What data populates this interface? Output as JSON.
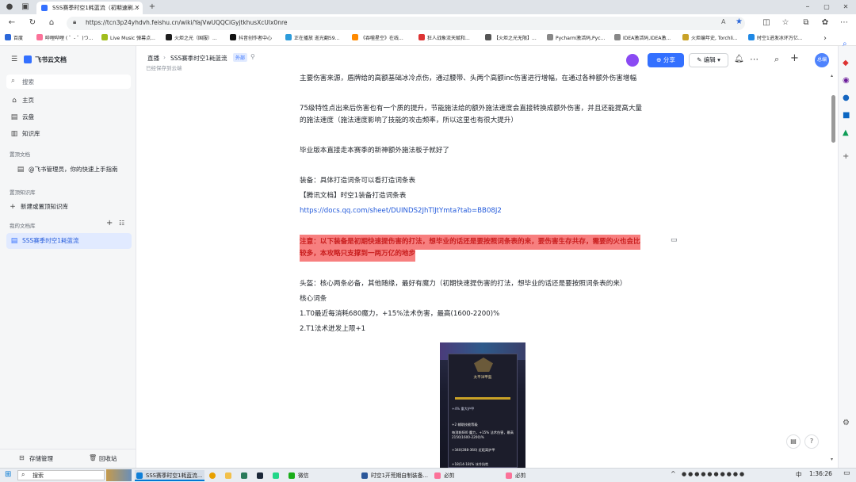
{
  "browser": {
    "tabs": [
      {
        "title": "SSS赛季时空1耗蓝流（初期速刷…",
        "active": true
      }
    ],
    "url": "https://tcn3p24yhdvh.feishu.cn/wiki/YajVwUQQCiGyjtkhusXcUlx0nre",
    "bookmarks": [
      {
        "label": "百度",
        "color": "#2b67d9"
      },
      {
        "label": "哔哩哔哩 ( ゜- ゜)つ...",
        "color": "#fb7299"
      },
      {
        "label": "Live Music 弹幕点...",
        "color": "#a1bd1c"
      },
      {
        "label": "火炬之光（国服）...",
        "color": "#1e1e1e"
      },
      {
        "label": "抖音创作者中心",
        "color": "#111111"
      },
      {
        "label": "正在播放 逝光翻59...",
        "color": "#2d9cdb"
      },
      {
        "label": "《吞噬星空》在线...",
        "color": "#ff8a00"
      },
      {
        "label": "狂人战象流天赋和...",
        "color": "#d33"
      },
      {
        "label": "【火炬之光无限】...",
        "color": "#555"
      },
      {
        "label": "Pycharm激活码,Pyc...",
        "color": "#888"
      },
      {
        "label": "IDEA激活码,IDEA激...",
        "color": "#888"
      },
      {
        "label": "火炬编年史, Torchli...",
        "color": "#c9a227"
      },
      {
        "label": "时空1进发冰环万亿...",
        "color": "#1e88e5"
      }
    ]
  },
  "sidebar": {
    "logo": "飞书云文档",
    "search_placeholder": "搜索",
    "nav": [
      {
        "label": "主页",
        "icon": "home-icon"
      },
      {
        "label": "云盘",
        "icon": "cloud-drive-icon"
      },
      {
        "label": "知识库",
        "icon": "knowledge-base-icon"
      }
    ],
    "pinned_docs_title": "置顶文档",
    "pinned_doc": "@飞书管理员，你的快速上手指南",
    "pinned_kb_title": "置顶知识库",
    "new_kb_label": "新建或置顶知识库",
    "my_lib_title": "我的文档库",
    "my_lib_item": "SSS赛季时空1耗蓝流",
    "storage_label": "存储管理",
    "trash_label": "回收站"
  },
  "header": {
    "breadcrumb_root": "直播",
    "breadcrumb_doc": "SSS赛季时空1耗蓝流",
    "badge": "外部",
    "saved_status": "已经保存到云端",
    "share_label": "分享",
    "edit_label": "编辑",
    "avatar_text": "总编"
  },
  "content": {
    "lines": [
      "主要伤害来源，盾牌给的高额基础冰冷点伤，通过腰带、头两个高额inc伤害进行增幅，在通过各种额外伤害增幅",
      "75级特性点出来后伤害也有一个质的提升，节能施法给的额外施法速度会直接转换成额外伤害，并且还能提高大量",
      "的施法速度（施法速度影响了技能的攻击频率，所以这里也有很大提升）",
      "毕业版本直接走本赛季的新神额外施法板子就好了",
      "装备：具体打造词条可以看打造词条表",
      "【腾讯文档】时空1装备打造词条表",
      "https://docs.qq.com/sheet/DUINDS2JhTlJtYmta?tab=BB08J2",
      "注意：以下装备是初期快速提伤害的打法，想毕业的话还是要按照词条表的来，要伤害生存共存，需要的火也会比",
      "较多，本攻略只支撑到一两万亿的地步",
      "头盔：核心两条必备，其他随缘，最好有魔力（初期快速提伤害的打法，想毕业的话还是要按照词条表的来）",
      "核心词条",
      "1.T0最近每消耗680魔力，+15%法术伤害，最高(1600-2200)%",
      "2.T1法术迸发上限+1"
    ],
    "image_card": {
      "title": "太平洋甲盔",
      "lines": [
        "+2 辅助技能等级",
        "每消耗680 魔力，+15% 法术伤害，最高2150(1600-2200)%",
        "+340(288-360) 近距离护甲",
        "+4% 重大护甲",
        "+18(14-18)% 冰冷抗性"
      ]
    }
  },
  "taskbar": {
    "search_label": "搜索",
    "items": [
      "SSS赛季时空1耗蓝流...",
      "微信",
      "时空1开荒期自制装备...",
      "必剪",
      "必剪"
    ],
    "time": "1:36:26",
    "lang": "中"
  }
}
